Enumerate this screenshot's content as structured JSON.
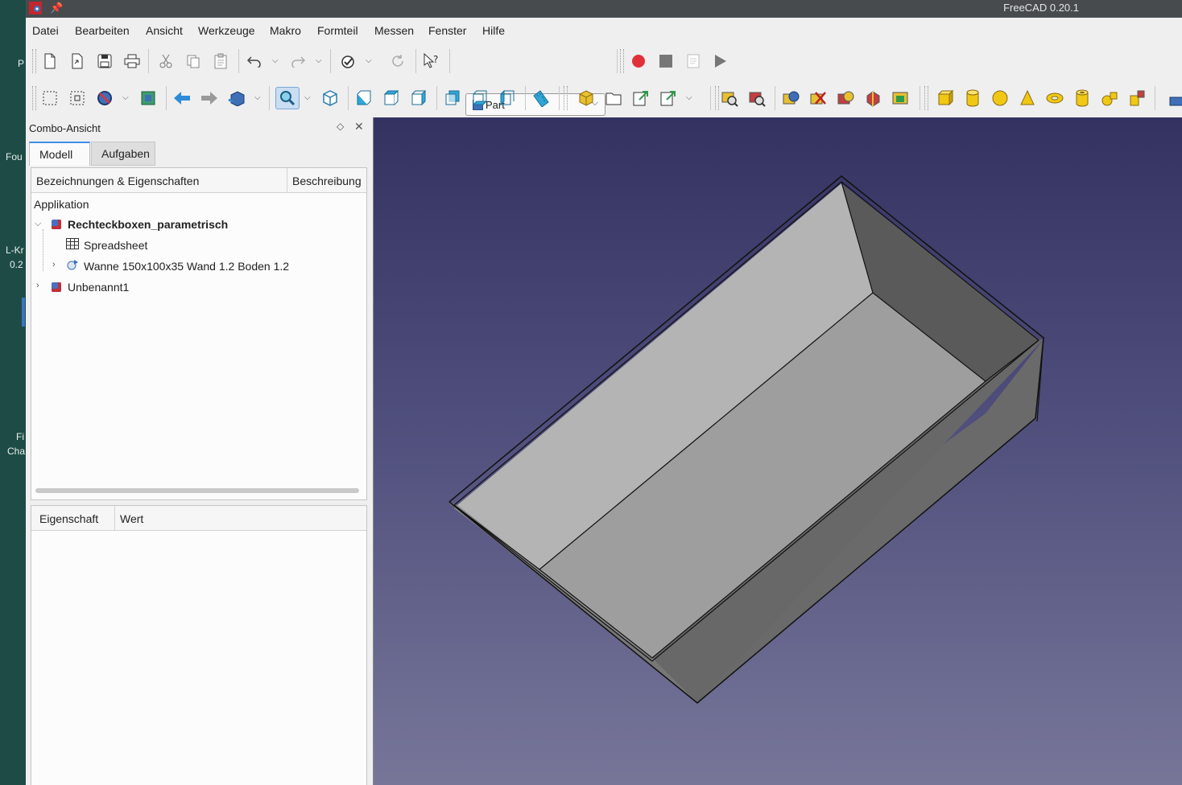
{
  "window": {
    "title": "FreeCAD 0.20.1"
  },
  "desktop_fragments": [
    "P",
    "Fou",
    "L-Kr",
    "0.2",
    "Fi",
    "Cha"
  ],
  "menu": [
    "Datei",
    "Bearbeiten",
    "Ansicht",
    "Werkzeuge",
    "Makro",
    "Formteil",
    "Messen",
    "Fenster",
    "Hilfe"
  ],
  "workbench": {
    "selected": "Part"
  },
  "colors": {
    "view_top": "#343260",
    "view_bottom": "#777699",
    "accent": "#3d8ee8"
  },
  "combo": {
    "title": "Combo-Ansicht",
    "tabs": [
      "Modell",
      "Aufgaben"
    ],
    "tree": {
      "headers": [
        "Bezeichnungen & Eigenschaften",
        "Beschreibung"
      ],
      "section": "Applikation",
      "items": [
        {
          "label": "Rechteckboxen_parametrisch",
          "icon": "document-icon"
        },
        {
          "label": "Spreadsheet",
          "icon": "spreadsheet-icon"
        },
        {
          "label": "Wanne 150x100x35 Wand 1.2 Boden 1.2",
          "icon": "part-feature-icon"
        },
        {
          "label": "Unbenannt1",
          "icon": "document-icon"
        }
      ]
    },
    "properties": {
      "headers": [
        "Eigenschaft",
        "Wert"
      ]
    }
  }
}
